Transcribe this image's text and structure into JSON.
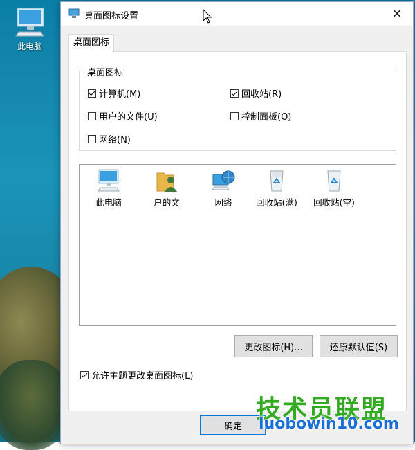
{
  "desktop": {
    "icon_label": "此电脑"
  },
  "window": {
    "title": "桌面图标设置",
    "close_glyph": "✕"
  },
  "tab": {
    "label": "桌面图标"
  },
  "group": {
    "legend": "桌面图标",
    "checkboxes": [
      {
        "label": "计算机(M)",
        "checked": true
      },
      {
        "label": "回收站(R)",
        "checked": true
      },
      {
        "label": "用户的文件(U)",
        "checked": false
      },
      {
        "label": "控制面板(O)",
        "checked": false
      },
      {
        "label": "网络(N)",
        "checked": false
      }
    ]
  },
  "icons": [
    {
      "label": "此电脑",
      "icon": "computer-icon"
    },
    {
      "label": "户的文",
      "icon": "user-folder-icon"
    },
    {
      "label": "网络",
      "icon": "network-icon"
    },
    {
      "label": "回收站(满)",
      "icon": "recycle-bin-full-icon"
    },
    {
      "label": "回收站(空)",
      "icon": "recycle-bin-empty-icon"
    }
  ],
  "buttons": {
    "change_icon": "更改图标(H)...",
    "restore_default": "还原默认值(S)",
    "ok": "确定"
  },
  "allow_theme": {
    "label": "允许主题更改桌面图标(L)",
    "checked": true
  },
  "watermark": {
    "line1": "技术员联盟",
    "line2": "luobowin10.com"
  },
  "colors": {
    "accent": "#0078d7",
    "desktop": "#1487ad"
  }
}
